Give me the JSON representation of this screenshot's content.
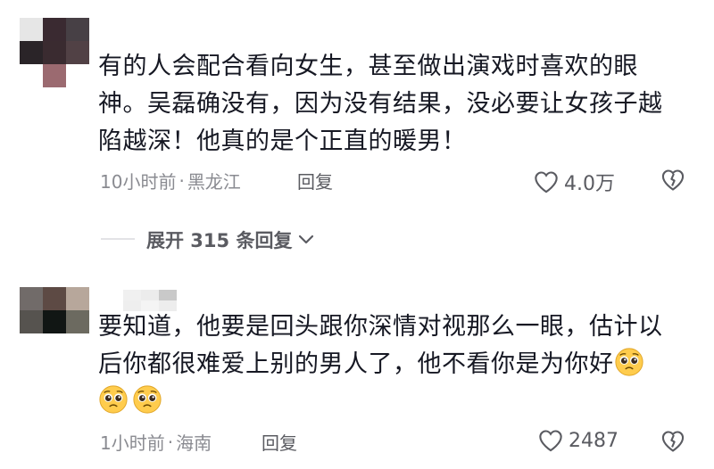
{
  "comments": [
    {
      "text": "有的人会配合看向女生，甚至做出演戏时喜欢的眼神。吴磊确没有，因为没有结果，没必要让女孩子越陷越深！他真的是个正直的暖男！",
      "lines": [
        "有的人会配合看向女生，甚至做出演戏时喜欢的眼",
        "神。吴磊确没有，因为没有结果，没必要让女孩子越",
        "陷越深！他真的是个正直的暖男！"
      ],
      "time": "10小时前",
      "location": "黑龙江",
      "separator": "·",
      "reply_label": "回复",
      "likes": "4.0万",
      "avatar_colors": [
        "#e6e6e6",
        "#3a2a31",
        "#474045",
        "#2a2428",
        "#3a2b30",
        "#514145",
        "#ffffff",
        "#9b6a70",
        "#ffffff"
      ]
    },
    {
      "text": "要知道，他要是回头跟你深情对视那么一眼，估计以后你都很难爱上别的男人了，他不看你是为你好🥺🥺🥺",
      "lines": [
        "要知道，他要是回头跟你深情对视那么一眼，估计以",
        "后你都很难爱上别的男人了，他不看你是为你好"
      ],
      "time": "1小时前",
      "location": "海南",
      "separator": "·",
      "reply_label": "回复",
      "likes": "2487",
      "avatar_colors": [
        "#716b69",
        "#5d4a44",
        "#b7a79b",
        "#56534f",
        "#111614",
        "#6c6a60"
      ],
      "name_blur_colors": [
        "#ffffff",
        "#f0f0f0",
        "#ececec",
        "#c9c9c9",
        "#ffffff",
        "#eeeeee",
        "#f4f4f4",
        "#ededed"
      ]
    }
  ],
  "expand_replies": {
    "label": "展开 315 条回复"
  },
  "colors": {
    "text": "#161823",
    "meta": "#8a8b91",
    "action": "#5a5b61"
  }
}
